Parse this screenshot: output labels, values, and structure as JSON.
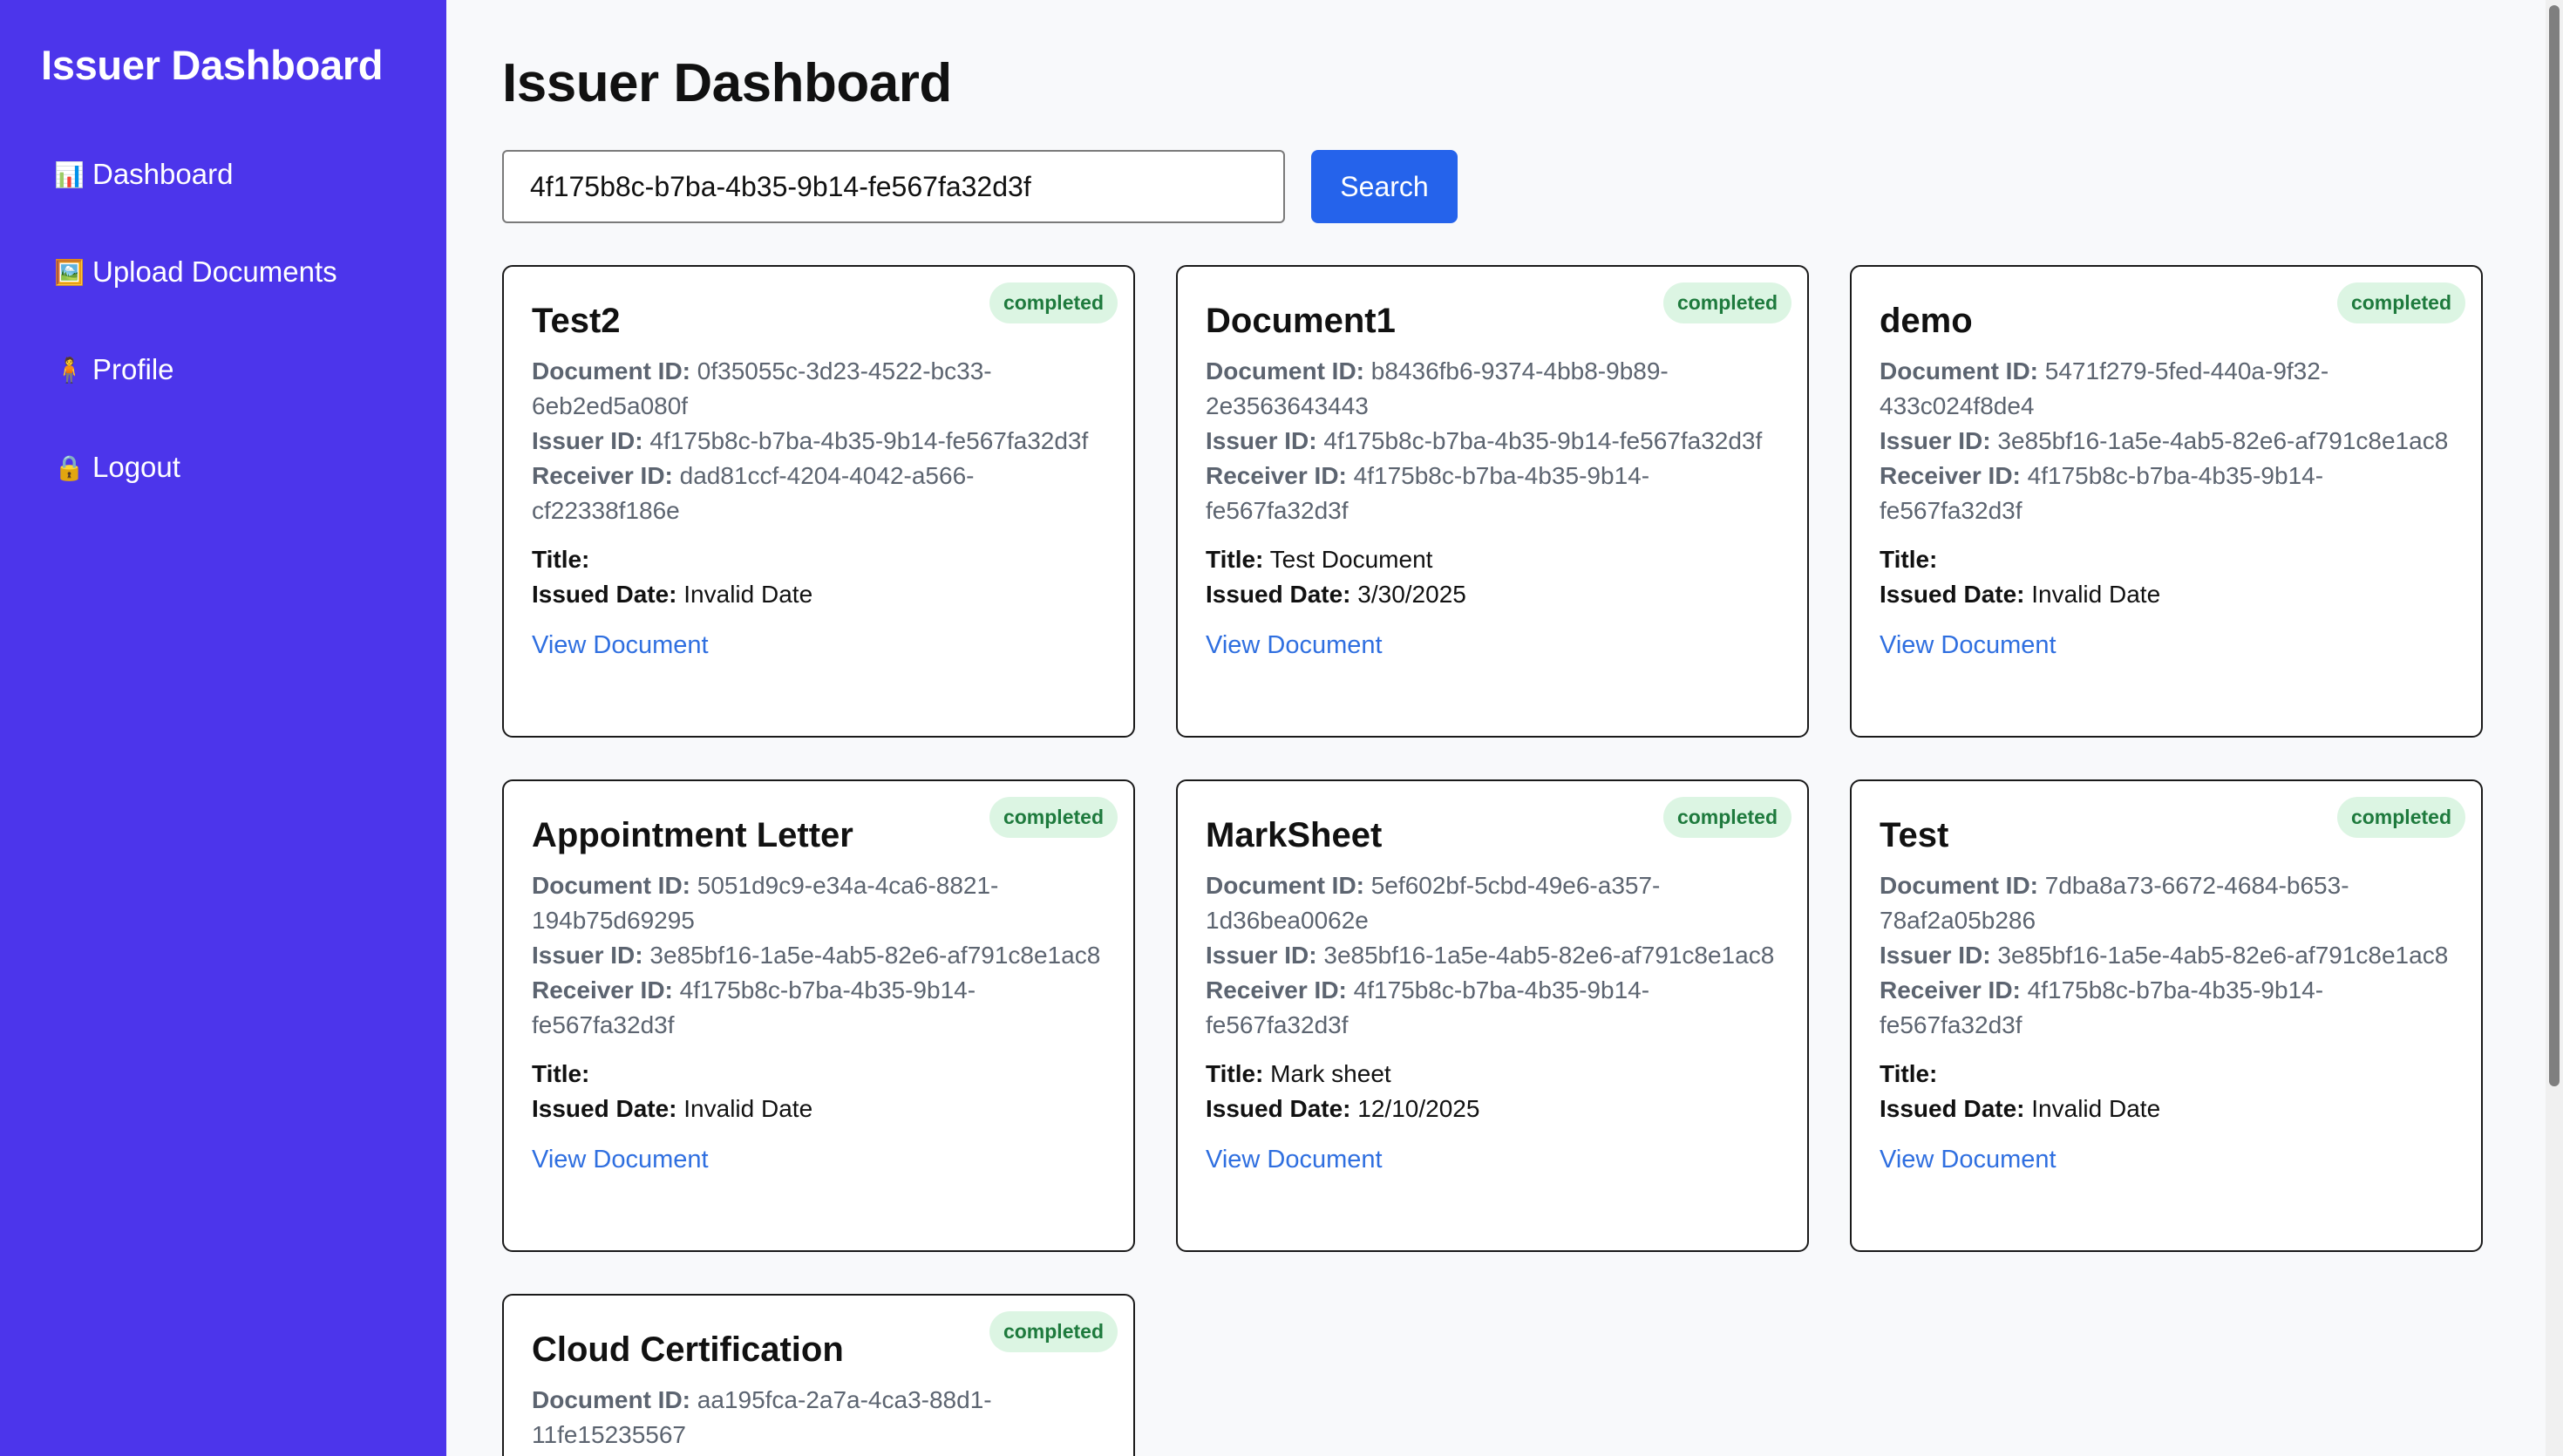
{
  "sidebar": {
    "brand": "Issuer Dashboard",
    "items": [
      {
        "icon": "📊",
        "icon_name": "chart-icon",
        "label": "Dashboard"
      },
      {
        "icon": "🖼️",
        "icon_name": "upload-icon",
        "label": "Upload Documents"
      },
      {
        "icon": "🧍",
        "icon_name": "person-icon",
        "label": "Profile"
      },
      {
        "icon": "🔒",
        "icon_name": "lock-icon",
        "label": "Logout"
      }
    ]
  },
  "main": {
    "title": "Issuer Dashboard",
    "search": {
      "value": "4f175b8c-b7ba-4b35-9b14-fe567fa32d3f",
      "button_label": "Search"
    }
  },
  "labels": {
    "document_id": "Document ID:",
    "issuer_id": "Issuer ID:",
    "receiver_id": "Receiver ID:",
    "title": "Title:",
    "issued_date": "Issued Date:",
    "view": "View Document"
  },
  "documents": [
    {
      "name": "Test2",
      "status": "completed",
      "document_id": "0f35055c-3d23-4522-bc33-6eb2ed5a080f",
      "issuer_id": "4f175b8c-b7ba-4b35-9b14-fe567fa32d3f",
      "receiver_id": "dad81ccf-4204-4042-a566-cf22338f186e",
      "title": "",
      "issued_date": "Invalid Date"
    },
    {
      "name": "Document1",
      "status": "completed",
      "document_id": "b8436fb6-9374-4bb8-9b89-2e3563643443",
      "issuer_id": "4f175b8c-b7ba-4b35-9b14-fe567fa32d3f",
      "receiver_id": "4f175b8c-b7ba-4b35-9b14-fe567fa32d3f",
      "title": "Test Document",
      "issued_date": "3/30/2025"
    },
    {
      "name": "demo",
      "status": "completed",
      "document_id": "5471f279-5fed-440a-9f32-433c024f8de4",
      "issuer_id": "3e85bf16-1a5e-4ab5-82e6-af791c8e1ac8",
      "receiver_id": "4f175b8c-b7ba-4b35-9b14-fe567fa32d3f",
      "title": "",
      "issued_date": "Invalid Date"
    },
    {
      "name": "Appointment Letter",
      "status": "completed",
      "document_id": "5051d9c9-e34a-4ca6-8821-194b75d69295",
      "issuer_id": "3e85bf16-1a5e-4ab5-82e6-af791c8e1ac8",
      "receiver_id": "4f175b8c-b7ba-4b35-9b14-fe567fa32d3f",
      "title": "",
      "issued_date": "Invalid Date"
    },
    {
      "name": "MarkSheet",
      "status": "completed",
      "document_id": "5ef602bf-5cbd-49e6-a357-1d36bea0062e",
      "issuer_id": "3e85bf16-1a5e-4ab5-82e6-af791c8e1ac8",
      "receiver_id": "4f175b8c-b7ba-4b35-9b14-fe567fa32d3f",
      "title": "Mark sheet",
      "issued_date": "12/10/2025"
    },
    {
      "name": "Test",
      "status": "completed",
      "document_id": "7dba8a73-6672-4684-b653-78af2a05b286",
      "issuer_id": "3e85bf16-1a5e-4ab5-82e6-af791c8e1ac8",
      "receiver_id": "4f175b8c-b7ba-4b35-9b14-fe567fa32d3f",
      "title": "",
      "issued_date": "Invalid Date"
    },
    {
      "name": "Cloud Certification",
      "status": "completed",
      "document_id": "aa195fca-2a7a-4ca3-88d1-11fe15235567"
    }
  ]
}
